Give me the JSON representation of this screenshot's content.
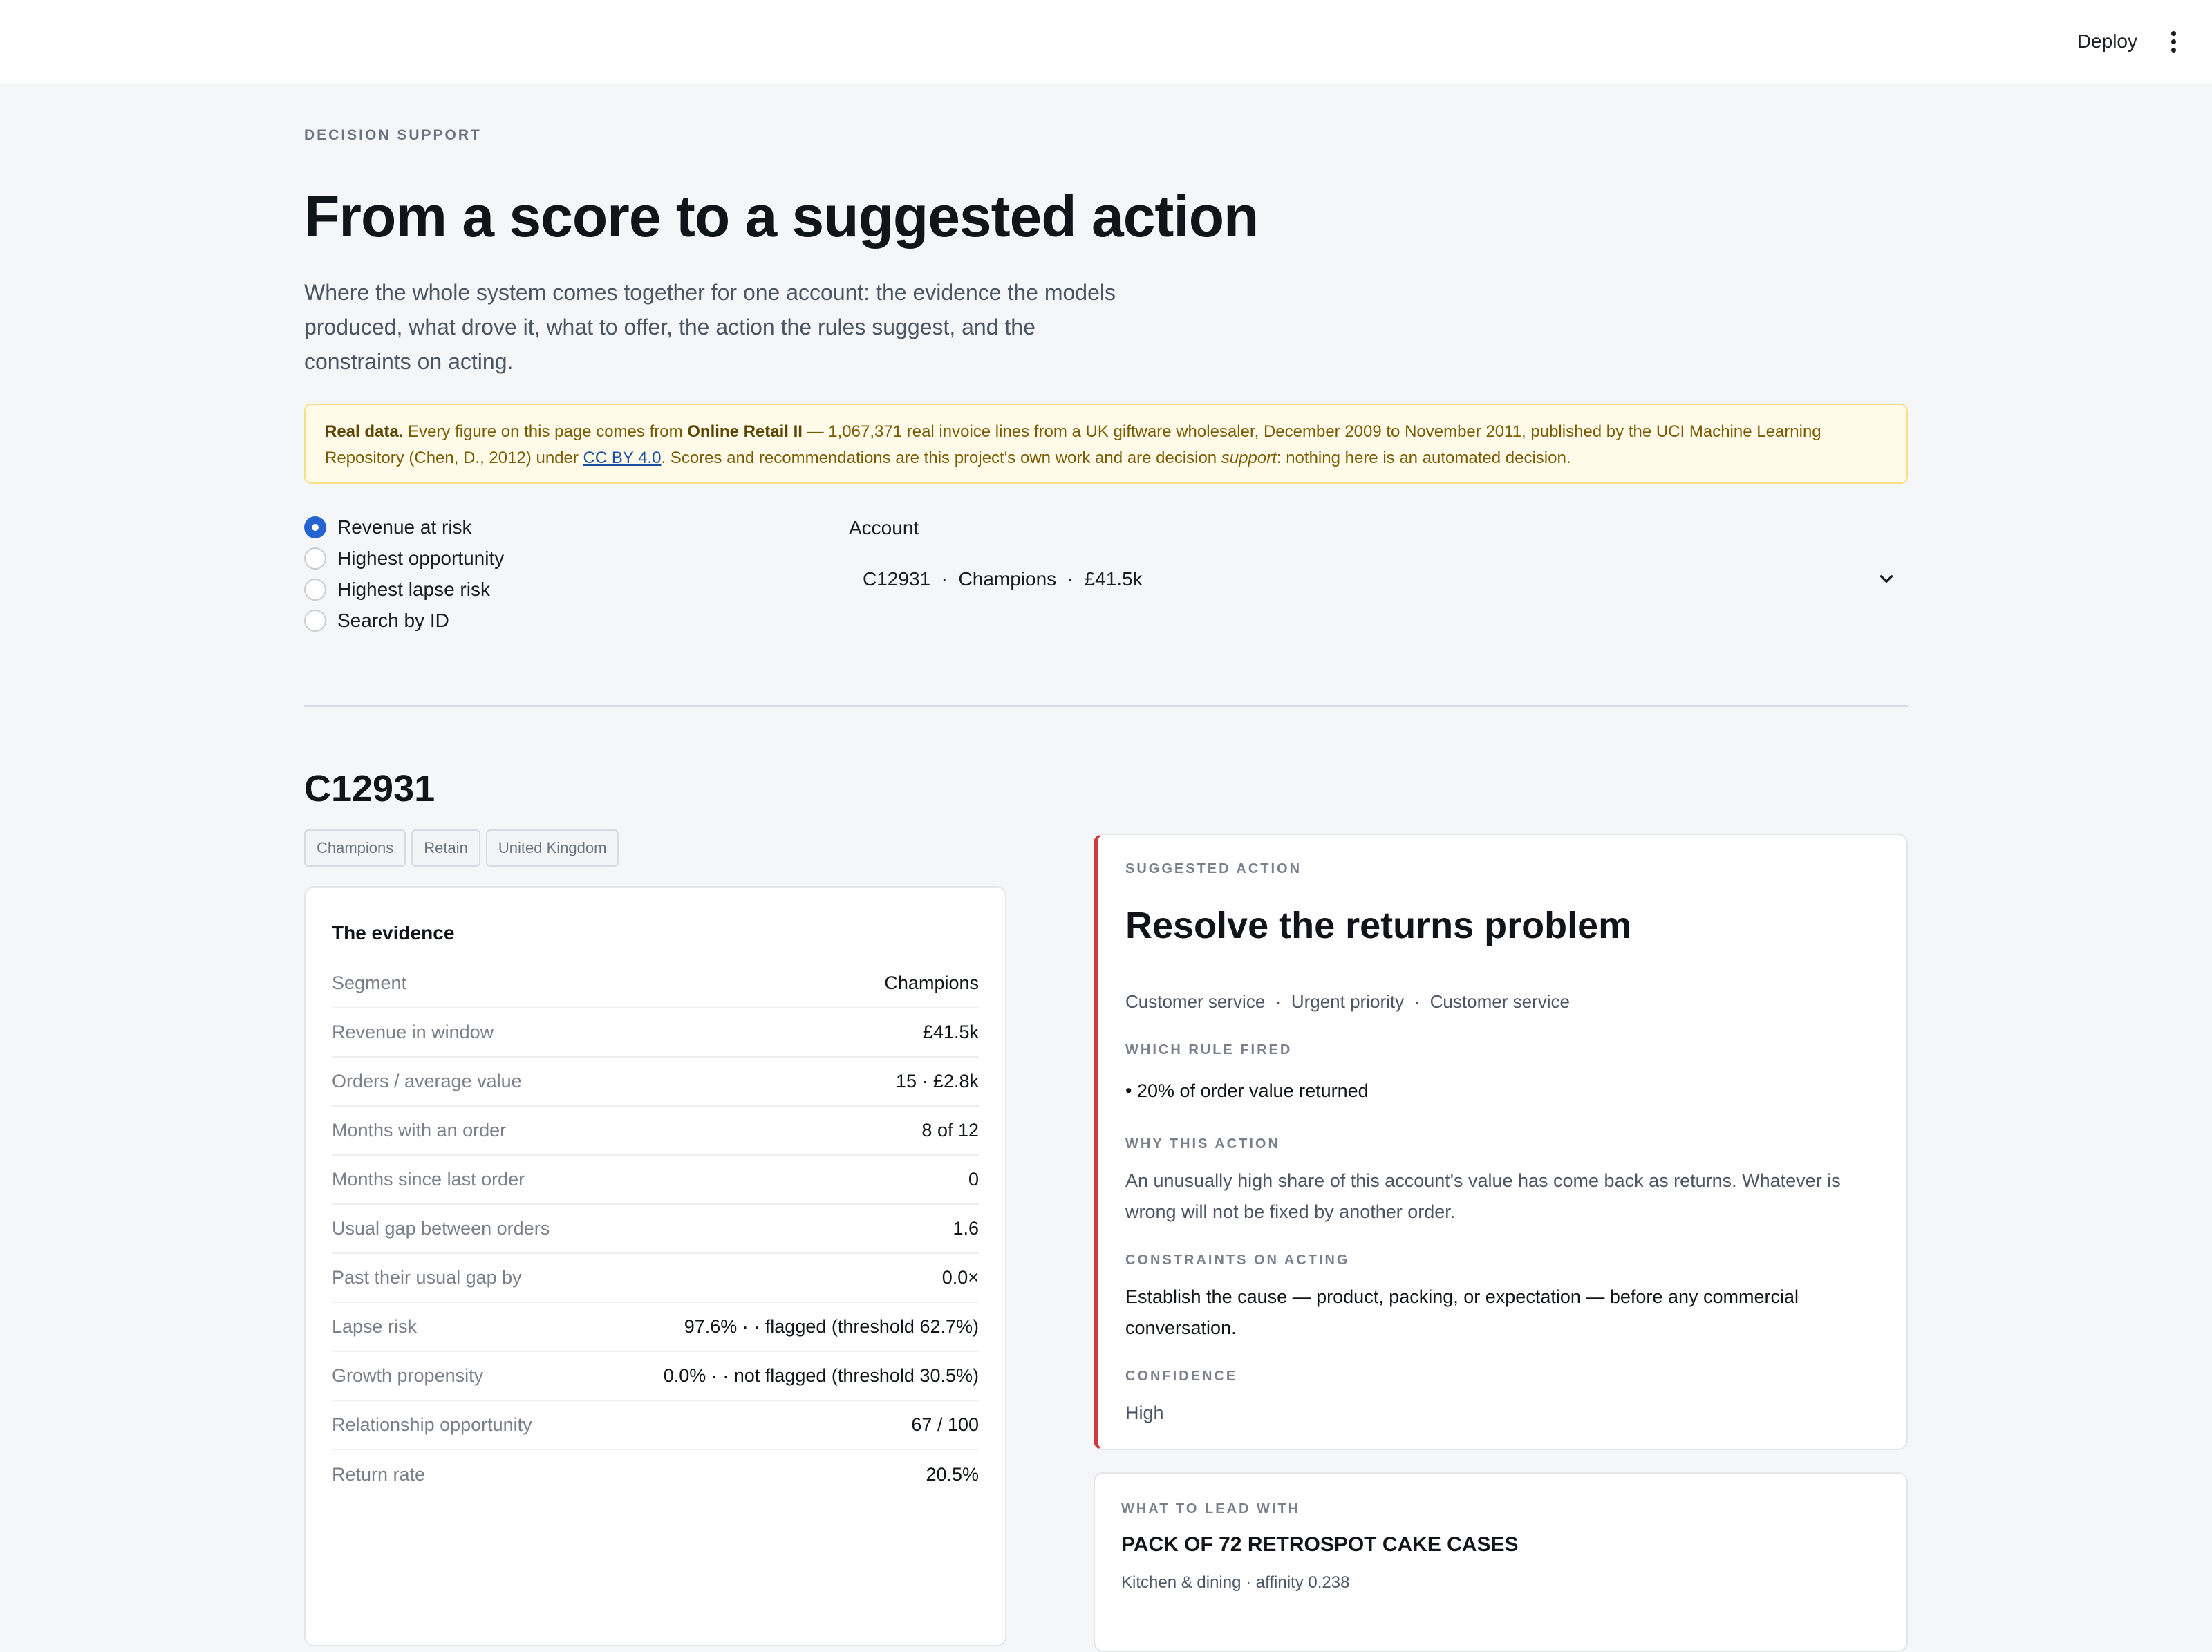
{
  "topbar": {
    "deploy_label": "Deploy",
    "menu_icon": "kebab-menu-icon"
  },
  "header": {
    "eyebrow": "DECISION SUPPORT",
    "title": "From a score to a suggested action",
    "lede": "Where the whole system comes together for one account: the evidence the models produced, what drove it, what to offer, the action the rules suggest, and the constraints on acting."
  },
  "notice": {
    "lead": "Real data.",
    "text1": " Every figure on this page comes from ",
    "source": "Online Retail II",
    "text2": " — 1,067,371 real invoice lines from a UK giftware wholesaler, December 2009 to November 2011, published by the UCI Machine Learning Repository (Chen, D., 2012) under ",
    "license": "CC BY 4.0",
    "text3": ". Scores and recommendations are this project's own work and are decision ",
    "emph": "support",
    "text4": ": nothing here is an automated decision."
  },
  "selector": {
    "options": [
      "Revenue at risk",
      "Highest opportunity",
      "Highest lapse risk",
      "Search by ID"
    ],
    "selected_index": 0,
    "account_label": "Account",
    "account_value": "C12931  ·  Champions  ·  £41.5k"
  },
  "account": {
    "id": "C12931",
    "tags": [
      "Champions",
      "Retain",
      "United Kingdom"
    ]
  },
  "evidence": {
    "title": "The evidence",
    "rows": [
      {
        "label": "Segment",
        "value": "Champions"
      },
      {
        "label": "Revenue in window",
        "value": "£41.5k"
      },
      {
        "label": "Orders / average value",
        "value": "15 · £2.8k"
      },
      {
        "label": "Months with an order",
        "value": "8 of 12"
      },
      {
        "label": "Months since last order",
        "value": "0"
      },
      {
        "label": "Usual gap between orders",
        "value": "1.6"
      },
      {
        "label": "Past their usual gap by",
        "value": "0.0×"
      },
      {
        "label": "Lapse risk",
        "value": "97.6% · · flagged (threshold 62.7%)"
      },
      {
        "label": "Growth propensity",
        "value": "0.0% · · not flagged (threshold 30.5%)"
      },
      {
        "label": "Relationship opportunity",
        "value": "67 / 100"
      },
      {
        "label": "Return rate",
        "value": "20.5%"
      }
    ]
  },
  "action": {
    "section_label": "SUGGESTED ACTION",
    "title": "Resolve the returns problem",
    "meta": "Customer service  ·  Urgent priority  ·  Customer service",
    "rule_label": "WHICH RULE FIRED",
    "rule": "• 20% of order value returned",
    "why_label": "WHY THIS ACTION",
    "why": "An unusually high share of this account's value has come back as returns. Whatever is wrong will not be fixed by another order.",
    "constraints_label": "CONSTRAINTS ON ACTING",
    "constraints": "Establish the cause — product, packing, or expectation — before any commercial conversation.",
    "confidence_label": "CONFIDENCE",
    "confidence": "High",
    "accent_color": "#d13b3b"
  },
  "lead_with": {
    "section_label": "WHAT TO LEAD WITH",
    "product": "PACK OF 72 RETROSPOT CAKE CASES",
    "detail": "Kitchen & dining · affinity 0.238"
  }
}
